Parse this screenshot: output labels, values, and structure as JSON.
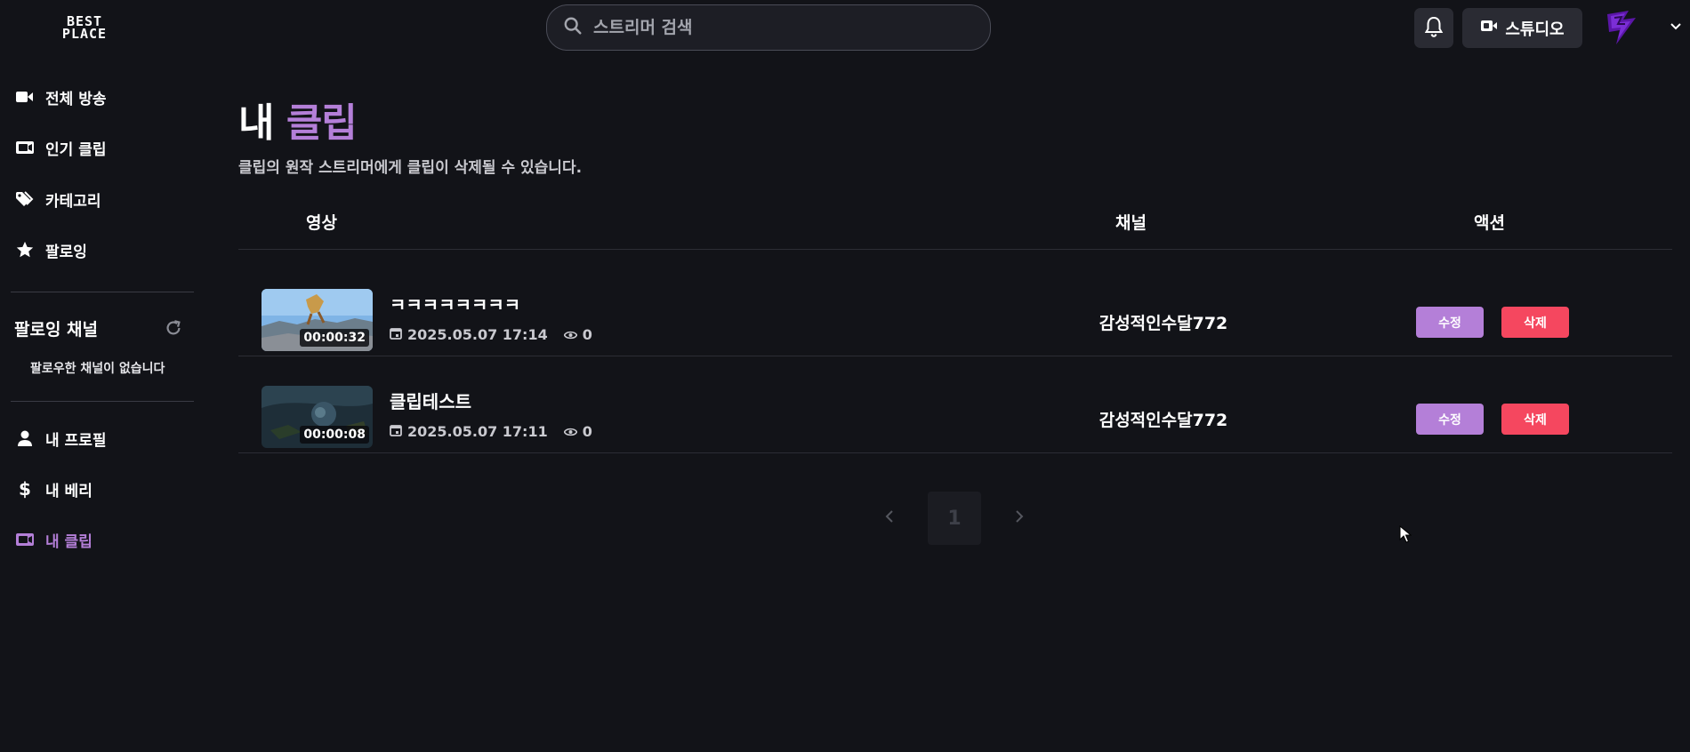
{
  "header": {
    "logo_line1": "BEST",
    "logo_line2": "PLACE",
    "search_placeholder": "스트리머 검색",
    "studio_label": "스튜디오"
  },
  "sidebar": {
    "nav": [
      {
        "label": "전체 방송",
        "icon": "video-camera-icon"
      },
      {
        "label": "인기 클립",
        "icon": "clip-icon"
      },
      {
        "label": "카테고리",
        "icon": "tags-icon"
      },
      {
        "label": "팔로잉",
        "icon": "star-icon"
      }
    ],
    "following_title": "팔로잉 채널",
    "following_empty": "팔로우한 채널이 없습니다",
    "account": [
      {
        "label": "내 프로필",
        "icon": "user-icon"
      },
      {
        "label": "내 베리",
        "icon": "dollar-icon"
      },
      {
        "label": "내 클립",
        "icon": "clip-icon",
        "active": true
      }
    ]
  },
  "main": {
    "title_prefix": "내",
    "title_accent": "클립",
    "description": "클립의 원작 스트리머에게 클립이 삭제될 수 있습니다.",
    "columns": {
      "video": "영상",
      "channel": "채널",
      "action": "액션"
    },
    "clips": [
      {
        "title": "ㅋㅋㅋㅋㅋㅋㅋㅋ",
        "duration": "00:00:32",
        "date": "2025.05.07 17:14",
        "views": "0",
        "channel": "감성적인수달772",
        "edit": "수정",
        "delete": "삭제"
      },
      {
        "title": "클립테스트",
        "duration": "00:00:08",
        "date": "2025.05.07 17:11",
        "views": "0",
        "channel": "감성적인수달772",
        "edit": "수정",
        "delete": "삭제"
      }
    ],
    "pagination": {
      "current": "1"
    }
  },
  "colors": {
    "background": "#121318",
    "accent": "#b47fd8",
    "danger": "#f5475f"
  }
}
